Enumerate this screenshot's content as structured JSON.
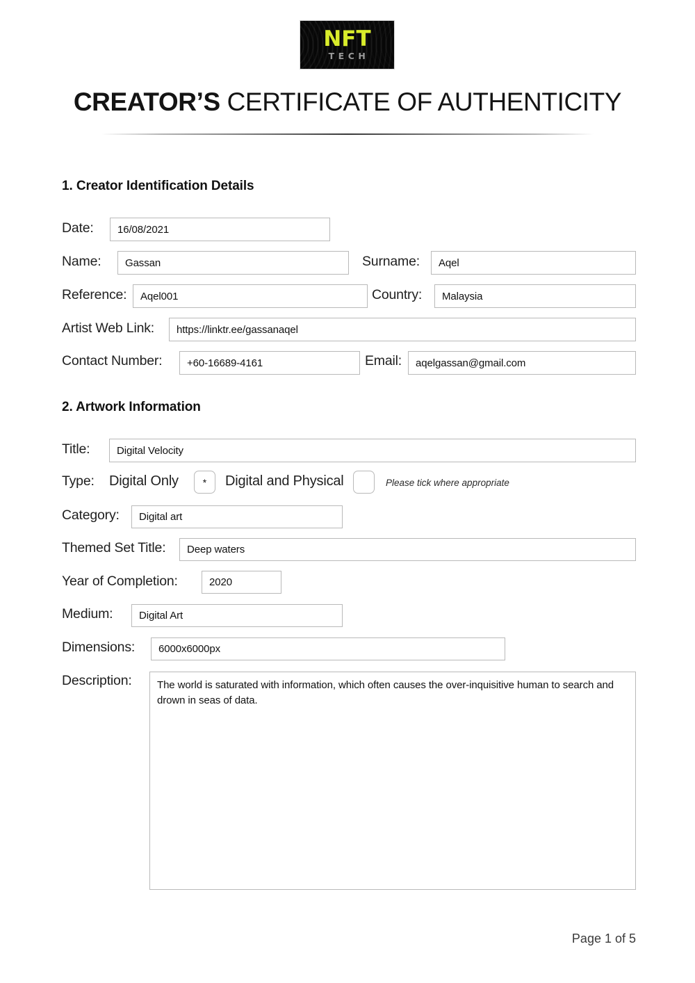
{
  "document": {
    "logo": {
      "primary_text": "NFT",
      "secondary_text": "TECH",
      "primary_color": "#d9ec2b",
      "secondary_color": "#9a9a9a",
      "background_color": "#060606"
    },
    "title_bold": "CREATOR’S",
    "title_rest": " CERTIFICATE OF AUTHENTICITY",
    "footer": "Page 1 of 5"
  },
  "section1": {
    "heading": "1. Creator Identification Details",
    "fields": {
      "date": {
        "label": "Date:",
        "value": "16/08/2021"
      },
      "name": {
        "label": "Name:",
        "value": "Gassan"
      },
      "surname": {
        "label": "Surname:",
        "value": "Aqel"
      },
      "reference": {
        "label": "Reference:",
        "value": "Aqel001"
      },
      "country": {
        "label": "Country:",
        "value": "Malaysia"
      },
      "web_link": {
        "label": "Artist Web Link:",
        "value": "https://linktr.ee/gassanaqel"
      },
      "contact": {
        "label": "Contact Number:",
        "value": "+60-16689-4161"
      },
      "email": {
        "label": "Email:",
        "value": "aqelgassan@gmail.com"
      }
    }
  },
  "section2": {
    "heading": "2. Artwork Information",
    "fields": {
      "title": {
        "label": "Title:",
        "value": "Digital Velocity"
      },
      "type": {
        "label": "Type:",
        "option_digital_only": "Digital Only",
        "option_digital_physical": "Digital and Physical",
        "digital_only_mark": "*",
        "digital_physical_mark": "",
        "note": "Please tick where appropriate"
      },
      "category": {
        "label": "Category:",
        "value": "Digital art"
      },
      "themed_set_title": {
        "label": "Themed Set Title:",
        "value": "Deep waters"
      },
      "year": {
        "label": "Year of Completion:",
        "value": "2020"
      },
      "medium": {
        "label": "Medium:",
        "value": "Digital Art"
      },
      "dimensions": {
        "label": "Dimensions:",
        "value": "6000x6000px"
      },
      "description": {
        "label": "Description:",
        "value": "The world is saturated with information, which often causes the over-inquisitive human to search and drown in seas of data."
      }
    }
  }
}
